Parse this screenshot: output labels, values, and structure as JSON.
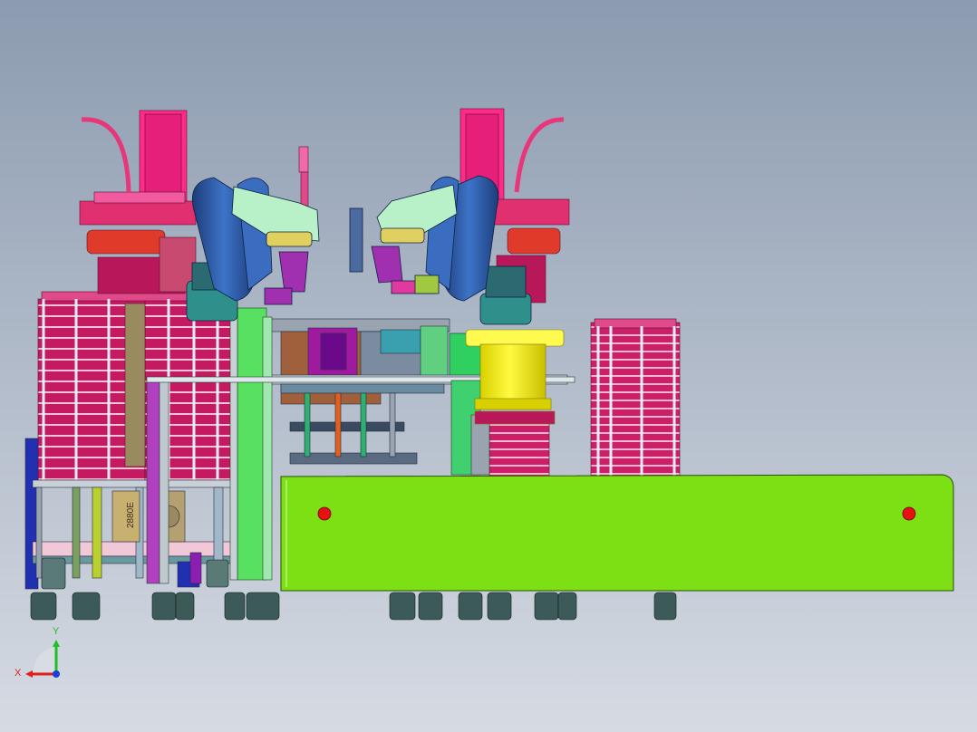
{
  "viewport": {
    "background_top": "#8c9bb0",
    "background_bottom": "#d6dbe3"
  },
  "label": {
    "text": "2880E"
  },
  "triad": {
    "x_label": "X",
    "y_label": "Y",
    "x_color": "#e0201a",
    "y_color": "#1fbf2a",
    "z_color": "#1a3fd6"
  },
  "colors": {
    "magenta": "#d4196a",
    "pink": "#f03e93",
    "hot_pink": "#ff2a8a",
    "red_motor": "#e03a2a",
    "robot_blue": "#2f5fb0",
    "robot_dark": "#1d3c7a",
    "cyan_base": "#2f8f8a",
    "green_bright": "#7de014",
    "yellow_cyl": "#f2ea10",
    "purple": "#8c1fb0",
    "frame_grey": "#b8c2cc",
    "wheel": "#3c5a58",
    "bolt_red": "#e81010"
  },
  "icons": {
    "triad": "axis-triad-icon"
  }
}
